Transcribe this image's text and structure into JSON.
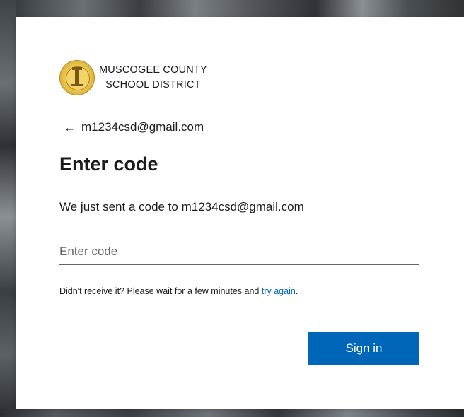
{
  "org": {
    "name_line1": "MUSCOGEE COUNTY",
    "name_line2": "SCHOOL DISTRICT",
    "logo_icon": "school-district-seal-icon"
  },
  "back": {
    "arrow": "←",
    "email": "m1234csd@gmail.com"
  },
  "page": {
    "title": "Enter code",
    "description": "We just sent a code to m1234csd@gmail.com"
  },
  "code_field": {
    "placeholder": "Enter code",
    "value": ""
  },
  "hint": {
    "text_before": "Didn't receive it? Please wait for a few minutes and ",
    "link": "try again",
    "text_after": "."
  },
  "actions": {
    "sign_in_label": "Sign in"
  },
  "colors": {
    "accent": "#0067b8",
    "text": "#1b1b1b",
    "placeholder": "#666666"
  }
}
